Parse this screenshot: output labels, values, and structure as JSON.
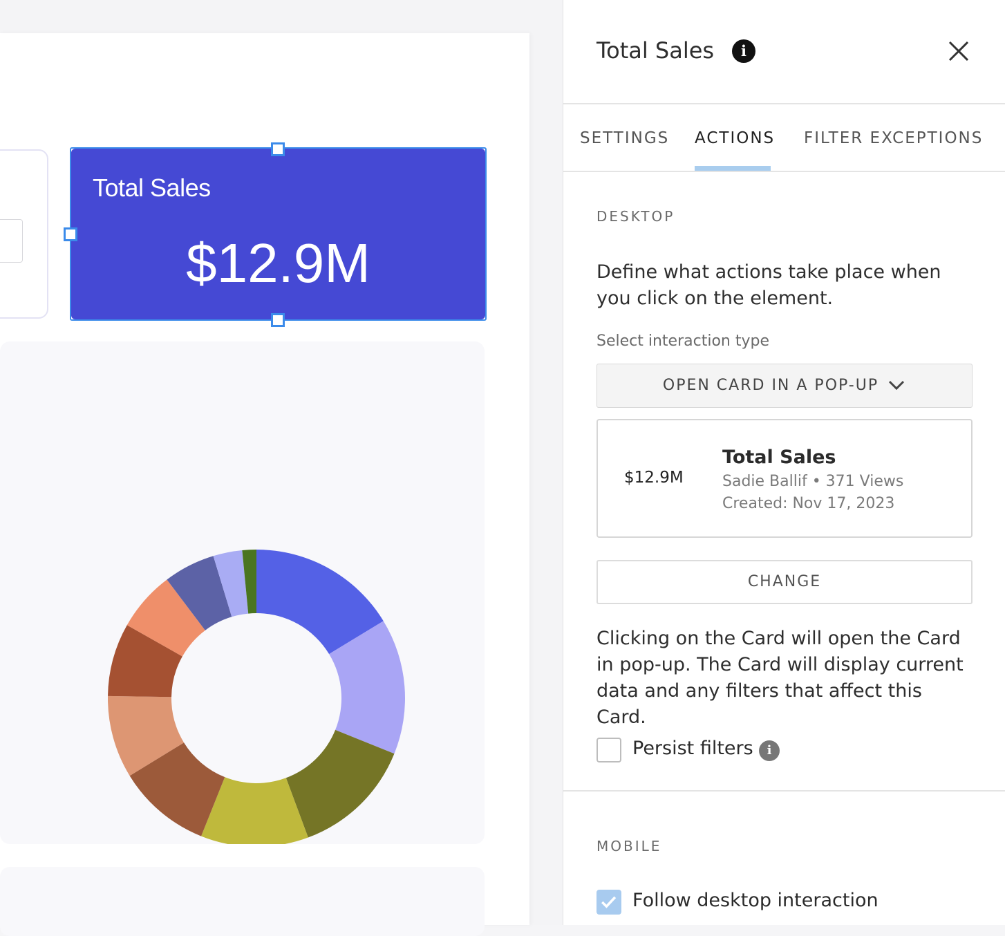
{
  "canvas": {
    "sales_card": {
      "title": "Total Sales",
      "value": "$12.9M",
      "background_color": "#4549d4"
    },
    "chart_data": {
      "type": "pie",
      "donut": true,
      "slices": [
        {
          "value": 16.0,
          "color": "#5461e6"
        },
        {
          "value": 14.5,
          "color": "#a9a5f5"
        },
        {
          "value": 13.0,
          "color": "#757526"
        },
        {
          "value": 11.5,
          "color": "#bfb93c"
        },
        {
          "value": 10.0,
          "color": "#9c5a3a"
        },
        {
          "value": 8.8,
          "color": "#dd9673"
        },
        {
          "value": 7.8,
          "color": "#a55132"
        },
        {
          "value": 6.4,
          "color": "#ef8f6a"
        },
        {
          "value": 5.5,
          "color": "#5c62a6"
        },
        {
          "value": 3.1,
          "color": "#a9acf4"
        },
        {
          "value": 1.5,
          "color": "#4a7520"
        }
      ]
    }
  },
  "panel": {
    "title": "Total Sales",
    "info_icon": "info-icon",
    "close_icon": "close-icon",
    "tabs": [
      {
        "label": "SETTINGS",
        "active": false
      },
      {
        "label": "ACTIONS",
        "active": true
      },
      {
        "label": "FILTER EXCEPTIONS",
        "active": false
      }
    ],
    "desktop": {
      "section_label": "DESKTOP",
      "description": "Define what actions take place when you click on the element.",
      "select_label": "Select interaction type",
      "select_value": "OPEN CARD IN A POP-UP",
      "preview": {
        "value": "$12.9M",
        "title": "Total Sales",
        "meta": "Sadie Ballif • 371 Views",
        "created": "Created: Nov 17, 2023"
      },
      "change_label": "CHANGE",
      "note": "Clicking on the Card will open the Card in pop-up. The Card will display current data and any filters that affect this Card.",
      "persist_label": "Persist filters",
      "persist_checked": false
    },
    "mobile": {
      "section_label": "MOBILE",
      "follow_label": "Follow desktop interaction",
      "follow_checked": true
    },
    "accent_color": "#a9cdee"
  }
}
